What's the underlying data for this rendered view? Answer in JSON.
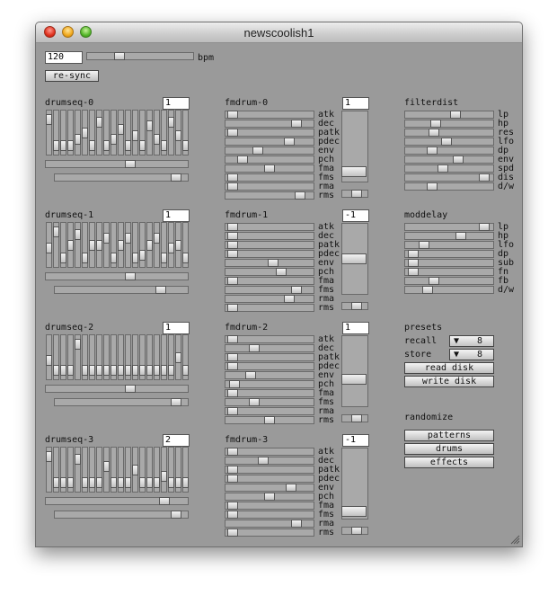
{
  "window": {
    "title": "newscoolish1"
  },
  "tempo": {
    "value": "120",
    "unit": "bpm",
    "slider": 0.28,
    "resync_label": "re-sync"
  },
  "drumseqs": [
    {
      "label": "drumseq-0",
      "value": "1",
      "steps": [
        0.9,
        0.1,
        0.1,
        0.1,
        0.3,
        0.5,
        0.1,
        0.8,
        0.1,
        0.3,
        0.6,
        0.1,
        0.4,
        0.1,
        0.7,
        0.3,
        0.1,
        0.8,
        0.4,
        0.1
      ],
      "slider_a": 0.6,
      "slider_b": 0.95
    },
    {
      "label": "drumseq-1",
      "value": "1",
      "steps": [
        0.4,
        0.9,
        0.1,
        0.5,
        0.8,
        0.1,
        0.5,
        0.5,
        0.7,
        0.1,
        0.5,
        0.7,
        0.1,
        0.2,
        0.5,
        0.7,
        0.1,
        0.4,
        0.5,
        0.1
      ],
      "slider_a": 0.6,
      "slider_b": 0.82
    },
    {
      "label": "drumseq-2",
      "value": "1",
      "steps": [
        0.4,
        0.1,
        0.1,
        0.1,
        0.9,
        0.1,
        0.1,
        0.1,
        0.1,
        0.1,
        0.1,
        0.1,
        0.1,
        0.1,
        0.1,
        0.1,
        0.1,
        0.1,
        0.5,
        0.1
      ],
      "slider_a": 0.6,
      "slider_b": 0.95
    },
    {
      "label": "drumseq-3",
      "value": "2",
      "steps": [
        0.9,
        0.1,
        0.1,
        0.1,
        0.8,
        0.1,
        0.1,
        0.1,
        0.6,
        0.1,
        0.1,
        0.1,
        0.5,
        0.1,
        0.1,
        0.1,
        0.3,
        0.1,
        0.1,
        0.1
      ],
      "slider_a": 0.86,
      "slider_b": 0.95
    }
  ],
  "fm_params": [
    "atk",
    "dec",
    "patk",
    "pdec",
    "env",
    "pch",
    "fma",
    "fms",
    "rma",
    "rms"
  ],
  "fmdrums": [
    {
      "label": "fmdrum-0",
      "value": "1",
      "params": [
        0.02,
        0.85,
        0.02,
        0.75,
        0.35,
        0.15,
        0.5,
        0.02,
        0.02,
        0.9
      ],
      "vslider": 0.07
    },
    {
      "label": "fmdrum-1",
      "value": "-1",
      "params": [
        0.02,
        0.02,
        0.02,
        0.02,
        0.55,
        0.65,
        0.02,
        0.85,
        0.75,
        0.02
      ],
      "vslider": 0.5
    },
    {
      "label": "fmdrum-2",
      "value": "1",
      "params": [
        0.02,
        0.3,
        0.02,
        0.02,
        0.25,
        0.05,
        0.02,
        0.3,
        0.02,
        0.5
      ],
      "vslider": 0.37
    },
    {
      "label": "fmdrum-3",
      "value": "-1",
      "params": [
        0.02,
        0.42,
        0.02,
        0.02,
        0.78,
        0.5,
        0.02,
        0.02,
        0.85,
        0.02
      ],
      "vslider": 0.03
    }
  ],
  "filterdist": {
    "label": "filterdist",
    "params": [
      {
        "name": "lp",
        "value": 0.58
      },
      {
        "name": "hp",
        "value": 0.33
      },
      {
        "name": "res",
        "value": 0.3
      },
      {
        "name": "lfo",
        "value": 0.46
      },
      {
        "name": "dp",
        "value": 0.28
      },
      {
        "name": "env",
        "value": 0.62
      },
      {
        "name": "spd",
        "value": 0.42
      },
      {
        "name": "dis",
        "value": 0.95
      },
      {
        "name": "d/w",
        "value": 0.28
      }
    ]
  },
  "moddelay": {
    "label": "moddelay",
    "params": [
      {
        "name": "lp",
        "value": 0.95
      },
      {
        "name": "hp",
        "value": 0.65
      },
      {
        "name": "lfo",
        "value": 0.18
      },
      {
        "name": "dp",
        "value": 0.03
      },
      {
        "name": "sub",
        "value": 0.03
      },
      {
        "name": "fn",
        "value": 0.03
      },
      {
        "name": "fb",
        "value": 0.3
      },
      {
        "name": "d/w",
        "value": 0.22
      }
    ]
  },
  "presets": {
    "label": "presets",
    "recall_label": "recall",
    "recall_value": "8",
    "store_label": "store",
    "store_value": "8",
    "read_label": "read disk",
    "write_label": "write disk"
  },
  "randomize": {
    "label": "randomize",
    "patterns_label": "patterns",
    "drums_label": "drums",
    "effects_label": "effects"
  }
}
